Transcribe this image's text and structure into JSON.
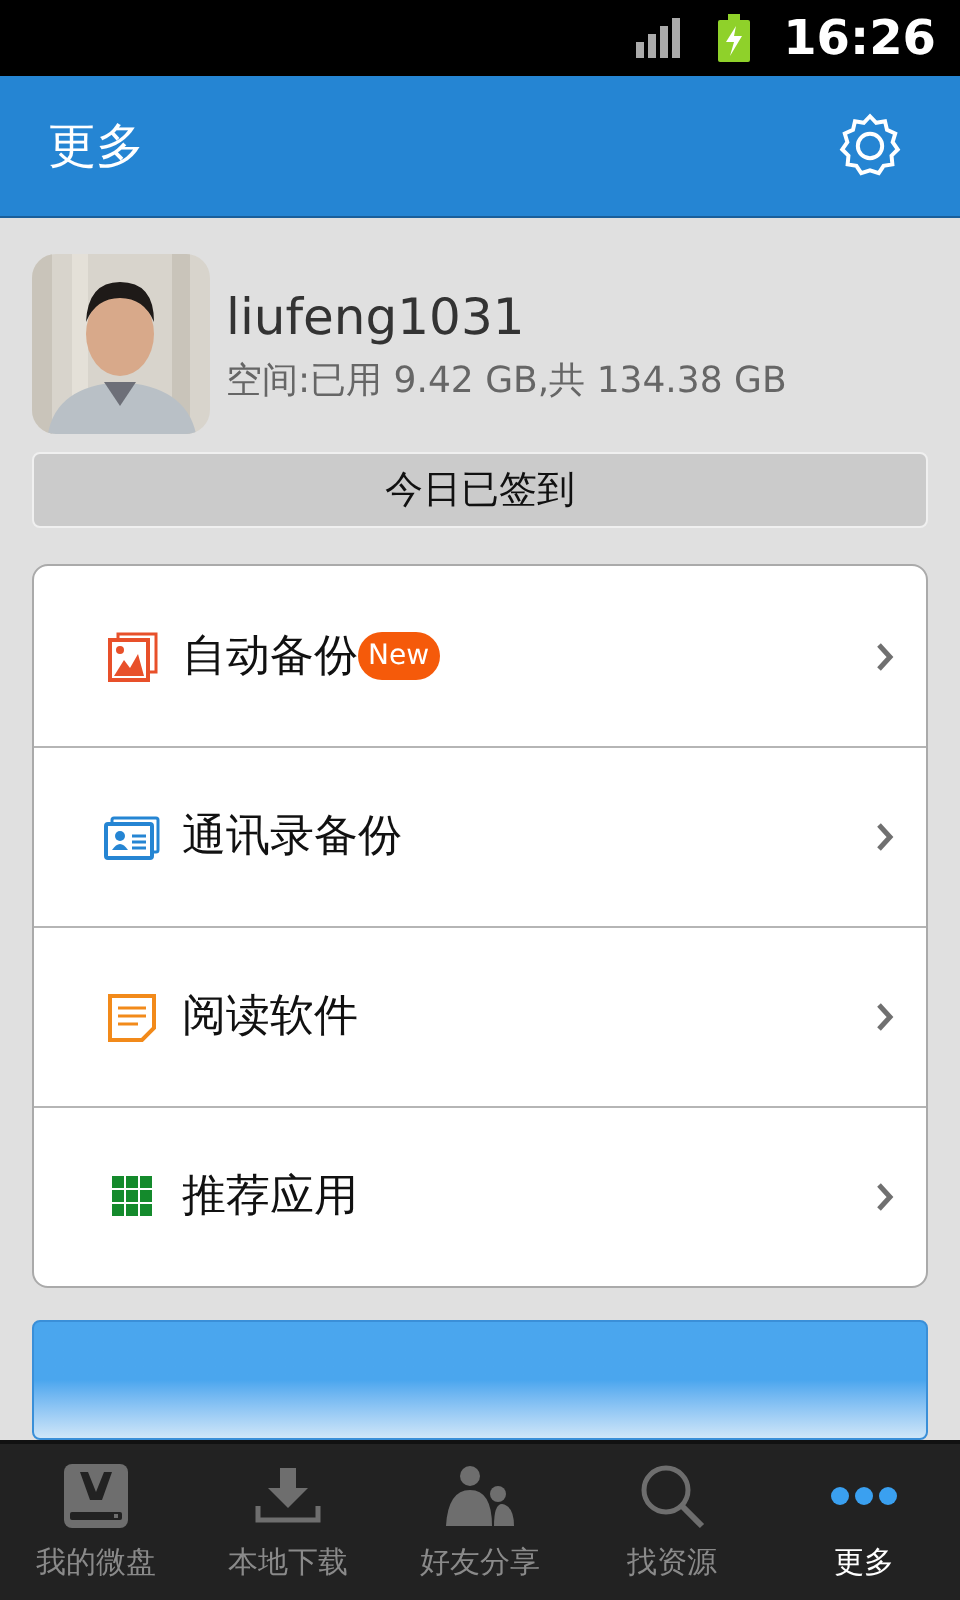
{
  "status_bar": {
    "time": "16:26"
  },
  "header": {
    "title": "更多"
  },
  "profile": {
    "username": "liufeng1031",
    "storage": "空间:已用 9.42 GB,共 134.38 GB"
  },
  "checkin_button": {
    "label": "今日已签到"
  },
  "menu": [
    {
      "kind": "photos",
      "label": "自动备份",
      "badge": "New"
    },
    {
      "kind": "contacts",
      "label": "通讯录备份"
    },
    {
      "kind": "reader",
      "label": "阅读软件"
    },
    {
      "kind": "apps",
      "label": "推荐应用"
    }
  ],
  "tabs": [
    {
      "kind": "disk",
      "label": "我的微盘",
      "selected": false
    },
    {
      "kind": "download",
      "label": "本地下载",
      "selected": false
    },
    {
      "kind": "friends",
      "label": "好友分享",
      "selected": false
    },
    {
      "kind": "search",
      "label": "找资源",
      "selected": false
    },
    {
      "kind": "more",
      "label": "更多",
      "selected": true
    }
  ]
}
